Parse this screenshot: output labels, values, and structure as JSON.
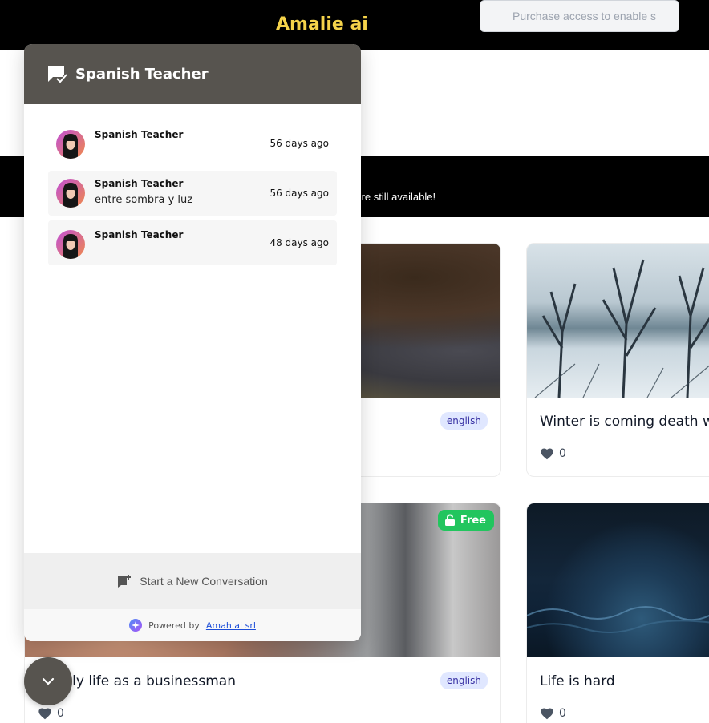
{
  "header": {
    "brand": "Amalie ai",
    "search_placeholder": "Purchase access to enable s"
  },
  "banner": {
    "text": "gs are still available!"
  },
  "cards": [
    {
      "title": "",
      "tag": "english",
      "likes": ""
    },
    {
      "title": "Winter is coming death wi",
      "tag": "",
      "likes": "0"
    },
    {
      "title": "aily life as a businessman",
      "tag": "english",
      "likes": "0",
      "badge": "Free"
    },
    {
      "title": "Life is hard",
      "tag": "",
      "likes": "0"
    }
  ],
  "chat": {
    "title": "Spanish Teacher",
    "conversations": [
      {
        "name": "Spanish Teacher",
        "preview": "",
        "time": "56 days ago"
      },
      {
        "name": "Spanish Teacher",
        "preview": "entre sombra y luz",
        "time": "56 days ago"
      },
      {
        "name": "Spanish Teacher",
        "preview": "",
        "time": "48 days ago"
      }
    ],
    "new_conversation": "Start a New Conversation",
    "powered_by": "Powered by",
    "powered_link": "Amah ai srl"
  },
  "icons": {
    "chat_header": "chat-check-icon",
    "new_conversation": "chat-plus-icon",
    "heart": "heart-icon",
    "unlock": "unlock-icon",
    "toggle": "chevron-down-icon"
  },
  "colors": {
    "brand": "#f5d34a",
    "chat_header": "#57544f",
    "tag_bg": "#e0e7ff",
    "free_badge": "#22c55e"
  }
}
